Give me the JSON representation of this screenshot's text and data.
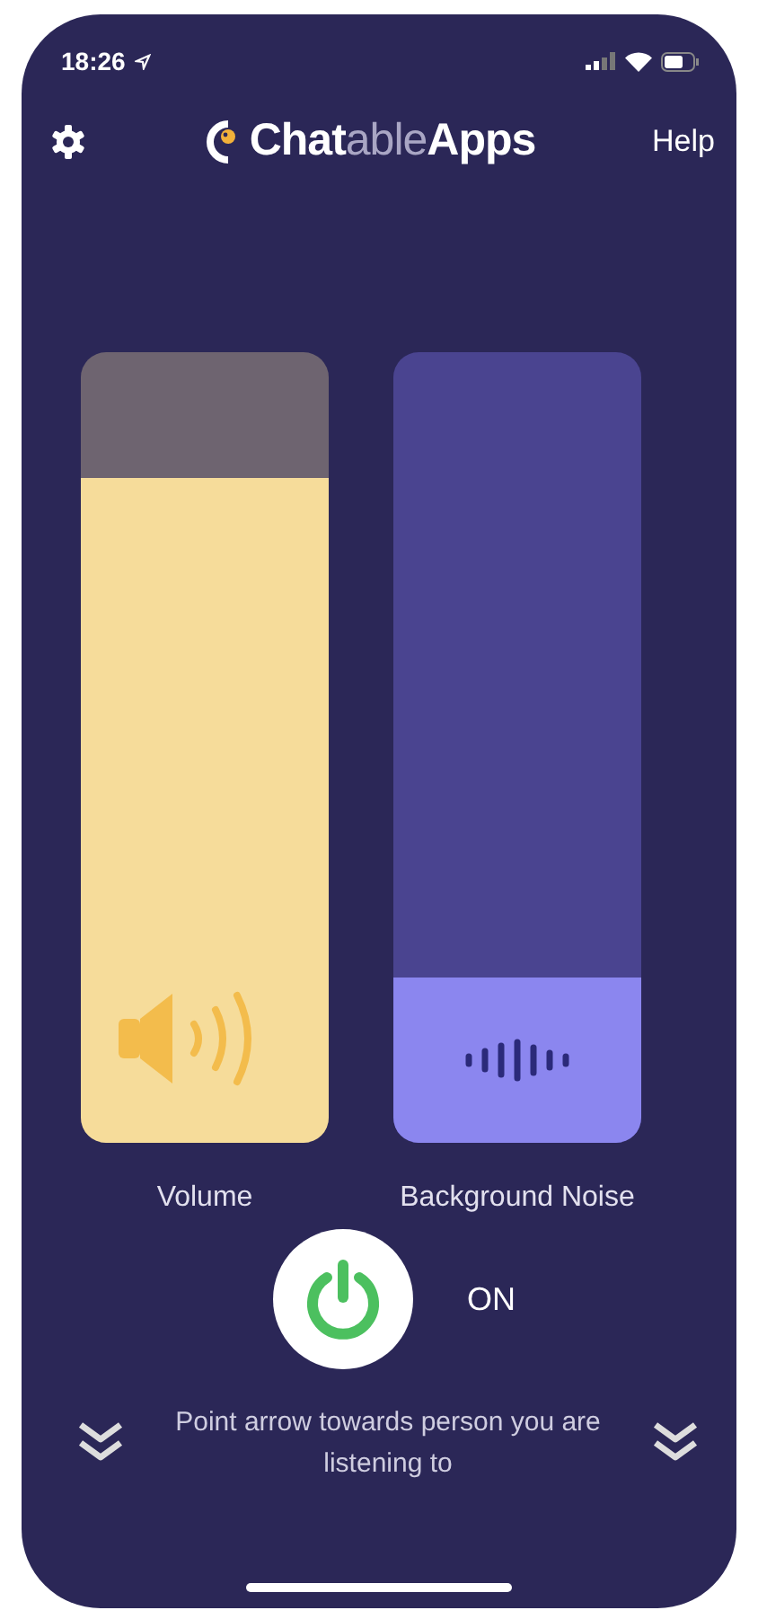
{
  "status_bar": {
    "time": "18:26"
  },
  "header": {
    "logo": [
      {
        "text": "Chat",
        "kind": "strong"
      },
      {
        "text": "able",
        "kind": "light"
      },
      {
        "text": "Apps",
        "kind": "strong"
      }
    ],
    "help": "Help"
  },
  "sliders": [
    {
      "kind": "volume",
      "label": "Volume",
      "level": 0.84
    },
    {
      "kind": "noise",
      "label": "Background Noise",
      "level": 0.21
    }
  ],
  "power": {
    "on": true,
    "label": "ON"
  },
  "hint": "Point arrow towards person you are listening to"
}
